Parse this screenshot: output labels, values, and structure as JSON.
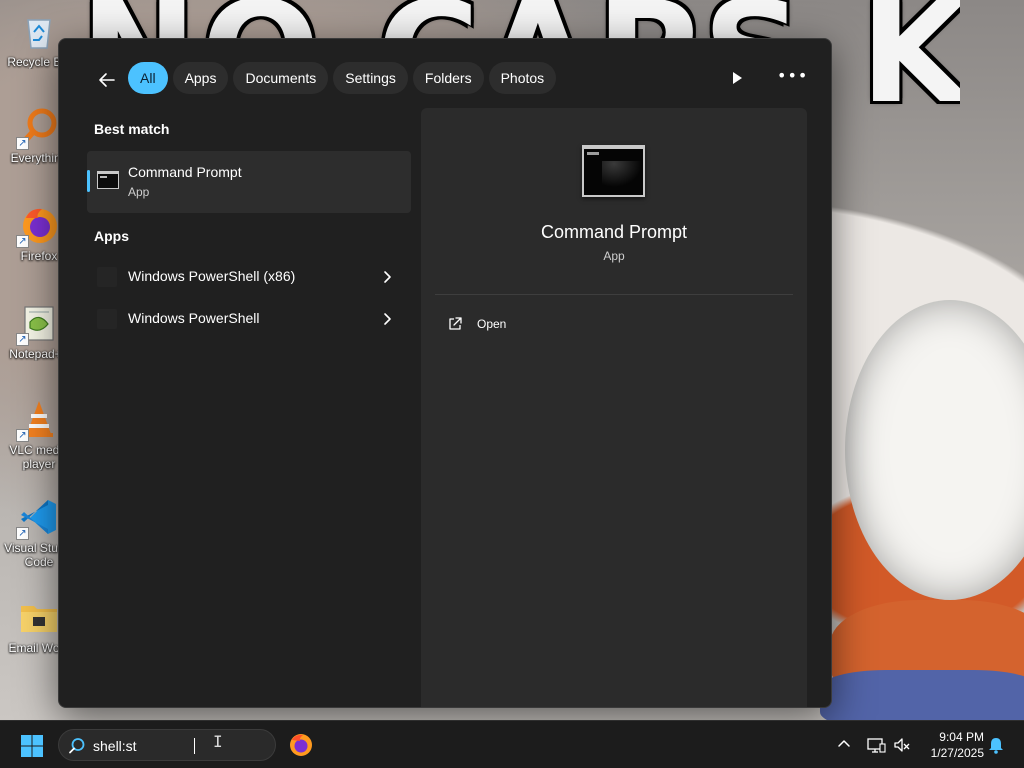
{
  "desktop": {
    "wallpaper_text": "NO CAPS KEYS?",
    "icons": [
      {
        "label": "Recycle Bin",
        "icon": "recycle-bin-icon"
      },
      {
        "label": "Everything",
        "icon": "search-app-icon"
      },
      {
        "label": "Firefox",
        "icon": "firefox-icon"
      },
      {
        "label": "Notepad++",
        "icon": "notepad-plus-plus-icon"
      },
      {
        "label": "VLC media player",
        "icon": "vlc-icon"
      },
      {
        "label": "Visual Studio Code",
        "icon": "vscode-icon"
      },
      {
        "label": "Email Work",
        "icon": "folder-icon"
      }
    ]
  },
  "search_panel": {
    "filters": [
      "All",
      "Apps",
      "Documents",
      "Settings",
      "Folders",
      "Photos"
    ],
    "active_filter": "All",
    "best_match_heading": "Best match",
    "best_match": {
      "title": "Command Prompt",
      "subtitle": "App"
    },
    "apps_heading": "Apps",
    "apps": [
      "Windows PowerShell (x86)",
      "Windows PowerShell"
    ],
    "detail": {
      "title": "Command Prompt",
      "subtitle": "App",
      "actions": [
        "Open"
      ]
    }
  },
  "taskbar": {
    "search_value": "shell:st",
    "time": "9:04 PM",
    "date": "1/27/2025"
  },
  "colors": {
    "accent": "#4cc2ff",
    "panel_bg": "#202020",
    "detail_bg": "#2b2b2b",
    "taskbar_bg": "#1c1c1c"
  }
}
